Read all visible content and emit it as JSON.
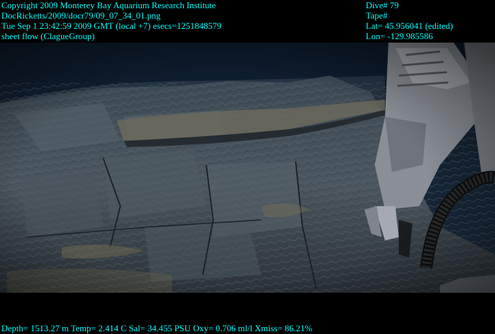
{
  "header": {
    "left_lines": [
      "Copyright 2009 Monterey Bay Aquarium Research Institute",
      "DocRicketts/2009/docr79/09_07_34_01.png",
      "Tue Sep  1 23:42:59 2009 GMT (local +7)  esecs=1251848579",
      "sheet flow (ClagueGroup)"
    ],
    "right_lines": [
      "Dive# 79",
      "Tape#",
      "Lat= 45.956041 (edited)",
      "Lon= -129.985586"
    ]
  },
  "footer": {
    "telemetry": "Depth= 1513.27 m  Temp= 2.414 C  Sal= 34.455 PSU  Oxy= 0.706 ml/l  Xmiss= 86.21%"
  },
  "colors": {
    "overlay_text": "#00ffff",
    "frame": "#000000"
  }
}
